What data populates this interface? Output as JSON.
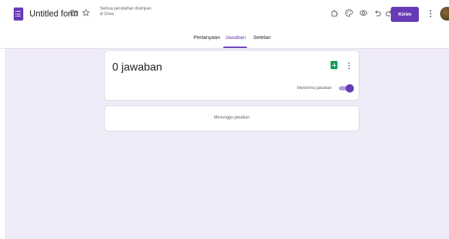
{
  "header": {
    "title": "Untitled form",
    "save_status_line1": "Semua perubahan disimpan",
    "save_status_line2": "di Drive",
    "send_label": "Kirim"
  },
  "icons": {
    "logo": "google-forms-logo",
    "folder": "folder-icon",
    "star": "star-icon",
    "addon": "puzzle-icon",
    "palette": "palette-icon",
    "preview": "eye-icon",
    "undo": "undo-icon",
    "redo": "redo-icon",
    "more": "more-vert-icon"
  },
  "tabs": [
    {
      "label": "Pertanyaan",
      "active": false
    },
    {
      "label": "Jawaban",
      "active": true
    },
    {
      "label": "Setelan",
      "active": false
    }
  ],
  "responses": {
    "count_label": "0 jawaban",
    "accepting_label": "Menerima jawaban",
    "accepting": true,
    "waiting_label": "Menunggu jawaban"
  },
  "colors": {
    "accent": "#673ab7",
    "background": "#f0ebf8",
    "sheets_green": "#0f9d58"
  }
}
